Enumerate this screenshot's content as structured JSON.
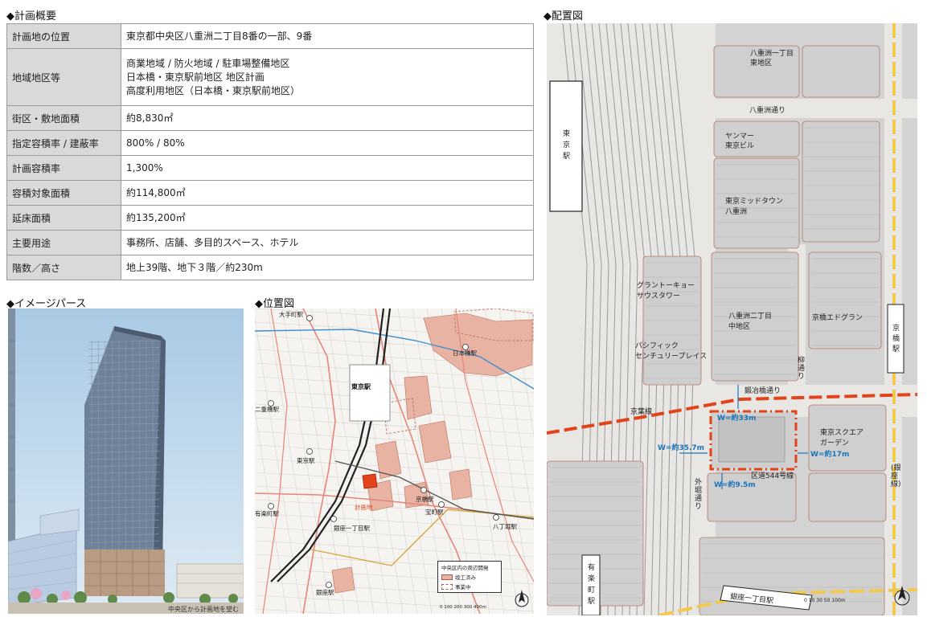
{
  "headings": {
    "plan_overview": "◆計画概要",
    "image_perspective": "◆イメージパース",
    "location_map": "◆位置図",
    "site_plan": "◆配置図"
  },
  "spec_table": [
    {
      "key": "計画地の位置",
      "lines": [
        "東京都中央区八重洲二丁目8番の一部、9番"
      ]
    },
    {
      "key": "地域地区等",
      "lines": [
        "商業地域 / 防火地域 / 駐車場整備地区",
        "日本橋・東京駅前地区 地区計画",
        "高度利用地区（日本橋・東京駅前地区）"
      ]
    },
    {
      "key": "街区・敷地面積",
      "lines": [
        "約8,830㎡"
      ]
    },
    {
      "key": "指定容積率 / 建蔽率",
      "lines": [
        "800% / 80%"
      ]
    },
    {
      "key": "計画容積率",
      "lines": [
        "1,300%"
      ]
    },
    {
      "key": "容積対象面積",
      "lines": [
        "約114,800㎡"
      ]
    },
    {
      "key": "延床面積",
      "lines": [
        "約135,200㎡"
      ]
    },
    {
      "key": "主要用途",
      "lines": [
        "事務所、店舗、多目的スペース、ホテル"
      ]
    },
    {
      "key": "階数／高さ",
      "lines": [
        "地上39階、地下３階／約230m"
      ]
    }
  ],
  "perspective": {
    "caption": "中央区から計画地を望む"
  },
  "location": {
    "stations": {
      "otemachi": "大手町駅",
      "nijubashimae": "二重橋駅",
      "tokyo_main": "東京駅",
      "tokyo": "東京駅",
      "yurakucho": "有楽町駅",
      "ginza_itchome": "銀座一丁目駅",
      "ginza": "銀座駅",
      "nihombashi": "日本橋駅",
      "kyobashi": "京橋駅",
      "takaracho": "宝町駅",
      "hatchobori": "八丁堀駅"
    },
    "site": "計画地",
    "legend": {
      "title": "中央区内の周辺開発",
      "completed": "竣工済み",
      "in_progress": "事業中"
    },
    "scale": "0  100  200  300  400m"
  },
  "siteplan": {
    "labels": {
      "yaesu1_east": "八重洲一丁目\n東地区",
      "yaesu_dori": "八重洲通り",
      "tokyo_station": "東\n京\n駅",
      "yanmar": "ヤンマー\n東京ビル",
      "midtown": "東京ミッドタウン\n八重洲",
      "granto": "グラントーキョー\nサウスタワー",
      "yaesu2_middle": "八重洲二丁目\n中地区",
      "kyobashi_edgran": "京橋エドグラン",
      "kyobashi_station": "京\n橋\n駅",
      "pacific": "パシフィック\nセンチュリープレイス",
      "yanagi_dori": "柳\n通\nり",
      "kajibashi": "鍛冶橋通り",
      "keiyo_line": "京葉線",
      "tokyo_square": "東京スクエア\nガーデン",
      "road544": "区道544号線",
      "sotobori": "外\n堀\n通\nり",
      "ginza_line": "(銀\n座\n線)",
      "yurakucho_station": "有\n楽\n町\n駅",
      "ginza_itchome_station": "銀座一丁目駅"
    },
    "widths": {
      "north": "W=約33m",
      "west": "W=約35.7m",
      "east": "W=約17m",
      "south": "W=約9.5m"
    },
    "scale": "0  10  30   50        100m"
  },
  "colors": {
    "table_key_bg": "#d9d9d9",
    "site_red": "#e2431a",
    "development_pink": "#e8b3a3",
    "road_blue": "#1b75bb",
    "rail_yellow": "#f2c94c"
  }
}
